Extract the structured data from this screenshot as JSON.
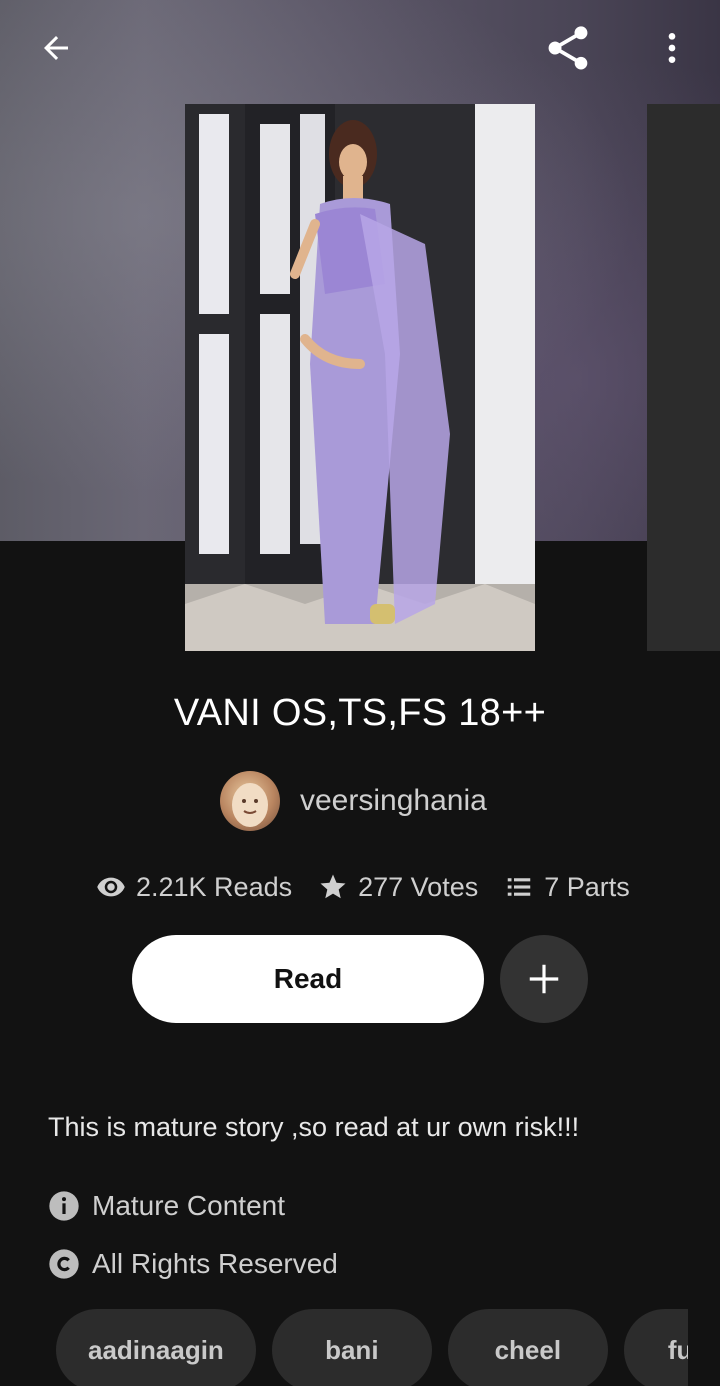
{
  "header": {
    "back_icon": "arrow-left-icon",
    "share_icon": "share-icon",
    "more_icon": "more-vertical-icon"
  },
  "story": {
    "title": "VANI OS,TS,FS 18++",
    "author": "veersinghania",
    "stats": {
      "reads": "2.21K Reads",
      "votes": "277 Votes",
      "parts": "7 Parts"
    },
    "read_label": "Read",
    "description": "This is mature story ,so read at ur own risk!!!",
    "mature_label": "Mature Content",
    "rights_label": "All Rights Reserved",
    "tags": [
      "aadinaagin",
      "bani",
      "cheel",
      "fu"
    ]
  },
  "colors": {
    "background": "#121212",
    "surface": "#2c2c2c",
    "text": "#ffffff",
    "muted": "#cfcfcf"
  }
}
